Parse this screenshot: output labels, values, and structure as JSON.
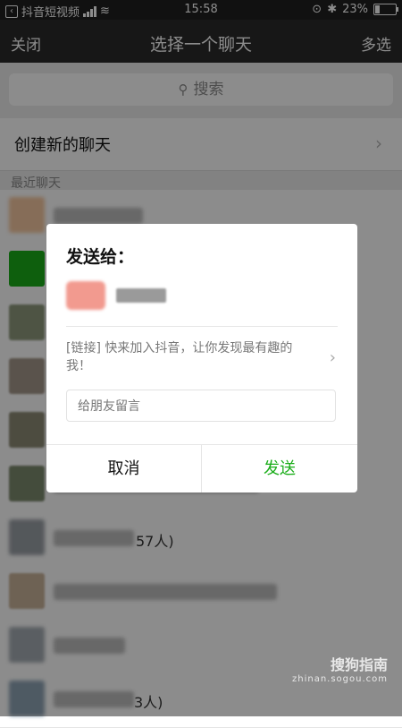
{
  "status_bar": {
    "app_back": "抖音短视频",
    "time": "15:58",
    "battery_percent": "23%",
    "battery_level": 0.23
  },
  "nav": {
    "close": "关闭",
    "title": "选择一个聊天",
    "multi_select": "多选"
  },
  "search": {
    "placeholder": "搜索"
  },
  "create_new": {
    "label": "创建新的聊天"
  },
  "recent_section": "最近聊天",
  "contacts": [
    {
      "suffix": ""
    },
    {
      "suffix": ""
    },
    {
      "suffix": ""
    },
    {
      "suffix": ""
    },
    {
      "suffix": ""
    },
    {
      "suffix": ""
    },
    {
      "suffix": "57人)"
    },
    {
      "suffix": ""
    },
    {
      "suffix": ""
    },
    {
      "suffix": "3人)"
    }
  ],
  "dialog": {
    "send_to": "发送给：",
    "link_text": "[链接] 快来加入抖音，让你发现最有趣的我！",
    "message_placeholder": "给朋友留言",
    "cancel": "取消",
    "send": "发送"
  },
  "watermark": {
    "main": "搜狗指南",
    "sub": "zhinan.sogou.com"
  },
  "colors": {
    "send_green": "#1aad19",
    "nav_bg": "#2b2b2b"
  }
}
